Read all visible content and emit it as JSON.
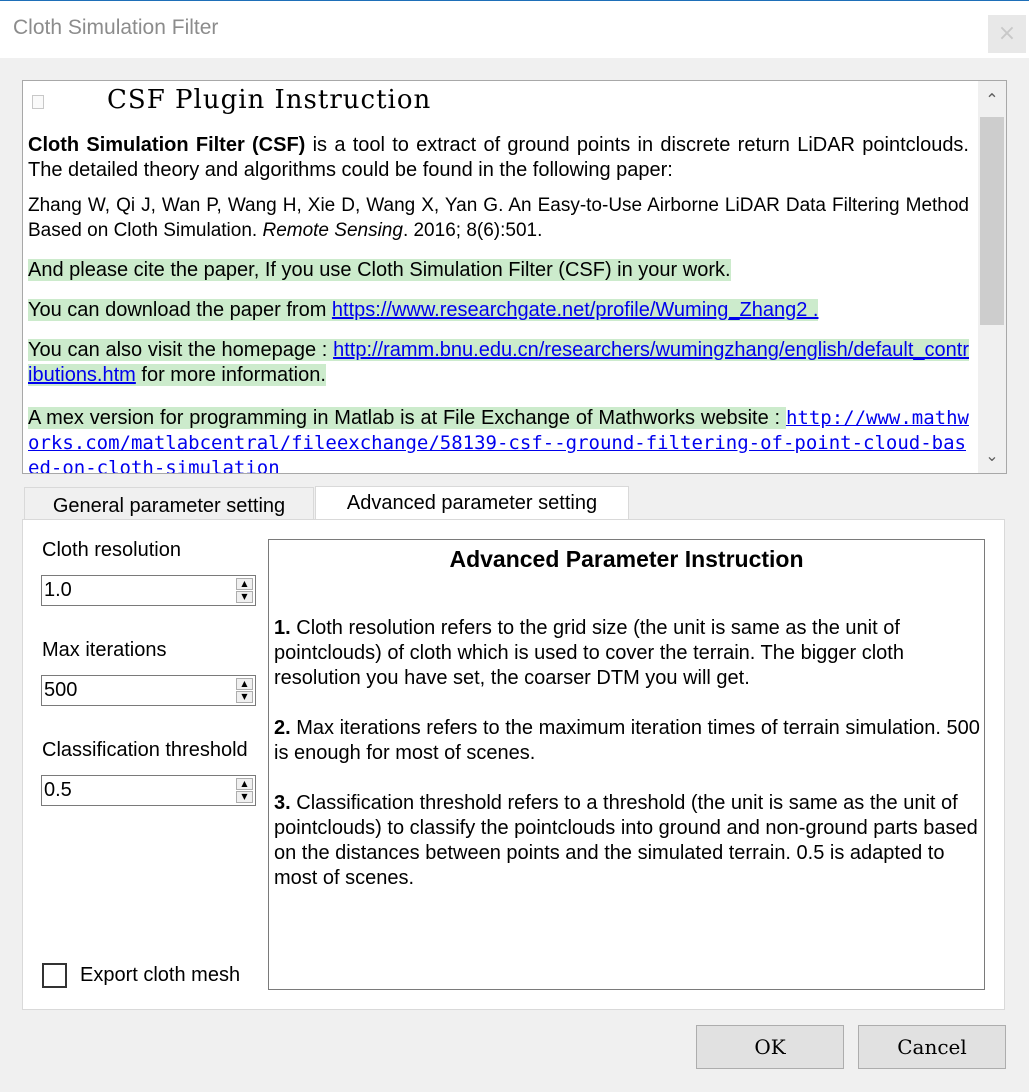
{
  "window": {
    "title": "Cloth Simulation Filter",
    "close_glyph": "×"
  },
  "instruction": {
    "heading": "CSF Plugin Instruction",
    "intro_bold": "Cloth Simulation Filter (CSF)",
    "intro_rest": " is a tool to extract of ground points in discrete return LiDAR pointclouds. The detailed theory and algorithms could be found in the following paper:",
    "citation_authors": "Zhang W, Qi J, Wan P, Wang H, Xie D, Wang X, Yan G. An Easy-to-Use Airborne LiDAR Data Filtering Method Based on Cloth Simulation. ",
    "citation_journal": "Remote Sensing",
    "citation_tail": ". 2016; 8(6):501.",
    "cite_note": "And please cite the paper, If you use Cloth Simulation Filter (CSF) in your work.",
    "download_prefix": "You can download the paper from ",
    "download_link": "https://www.researchgate.net/profile/Wuming_Zhang2 .",
    "homepage_prefix": "You can also visit the homepage : ",
    "homepage_link": "http://ramm.bnu.edu.cn/researchers/wumingzhang/english/default_contributions.htm",
    "homepage_suffix": " for more information.",
    "mex_prefix": "A mex version for programming in Matlab is at File Exchange of Mathworks website : ",
    "mex_link": "http://www.mathworks.com/matlabcentral/fileexchange/58139-csf--ground-filtering-of-point-cloud-based-on-cloth-simulation"
  },
  "tabs": [
    {
      "label": "General parameter setting",
      "active": false
    },
    {
      "label": "Advanced parameter setting",
      "active": true
    }
  ],
  "fields": {
    "cloth_resolution": {
      "label": "Cloth resolution",
      "value": "1.0"
    },
    "max_iterations": {
      "label": "Max iterations",
      "value": "500"
    },
    "classification_threshold": {
      "label": "Classification threshold",
      "value": "0.5"
    }
  },
  "export_mesh": {
    "label": "Export cloth mesh",
    "checked": false
  },
  "advanced": {
    "title": "Advanced Parameter Instruction",
    "p1_num": "1.",
    "p1": " Cloth resolution refers to the grid size (the unit is same as the unit of pointclouds) of cloth which is used to cover the terrain. The bigger cloth resolution you have set, the coarser DTM  you will get.",
    "p2_num": "2.",
    "p2": " Max iterations refers to the maximum iteration times of terrain simulation. 500 is enough for most of scenes.",
    "p3_num": "3.",
    "p3": " Classification threshold refers to a threshold (the unit is same as the unit of pointclouds) to classify the pointclouds into ground and non-ground parts based on the distances between points and the simulated terrain. 0.5 is adapted to most of scenes."
  },
  "buttons": {
    "ok": "OK",
    "cancel": "Cancel"
  },
  "icons": {
    "scroll_up": "chevron-up-icon",
    "scroll_down": "chevron-down-icon",
    "doc": "document-icon"
  },
  "colors": {
    "highlight": "#ccebcc",
    "link": "#0000ee",
    "title_accent": "#1e6fb8"
  }
}
